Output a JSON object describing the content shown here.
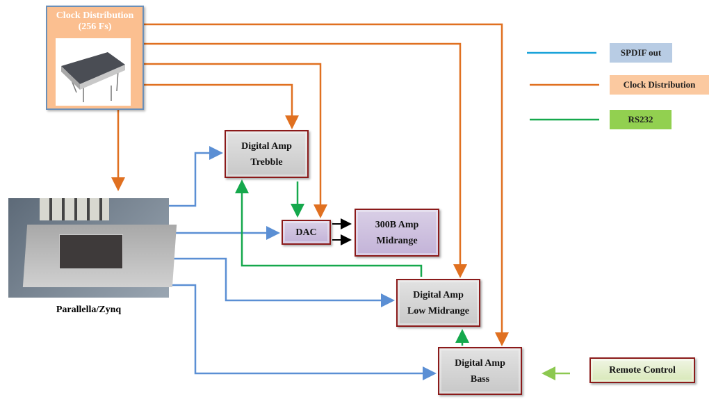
{
  "clock": {
    "title": "Clock Distribution",
    "subtitle": "(256 Fs)",
    "image": "crystal-oscillator"
  },
  "board": {
    "label": "Parallella/Zynq",
    "image": "parallella-board-photo"
  },
  "blocks": {
    "treble": [
      "Digital Amp",
      "Trebble"
    ],
    "dac": "DAC",
    "amp300b": [
      "300B Amp",
      "Midrange"
    ],
    "lowmid": [
      "Digital Amp",
      "Low Midrange"
    ],
    "bass": [
      "Digital Amp",
      "Bass"
    ],
    "remote": "Remote Control"
  },
  "legend": [
    {
      "label": "SPDIF out",
      "color": "#1aa3d9",
      "fill": "#b8cce4"
    },
    {
      "label": "Clock Distribution",
      "color": "#e07020",
      "fill": "#fbc9a0"
    },
    {
      "label": "RS232",
      "color": "#15a84c",
      "fill": "#92d050"
    }
  ],
  "colors": {
    "spdif_line": "#5b8fd4",
    "clock_line": "#e07020",
    "rs232_line": "#15a84c",
    "block_border": "#8b1a1a"
  }
}
